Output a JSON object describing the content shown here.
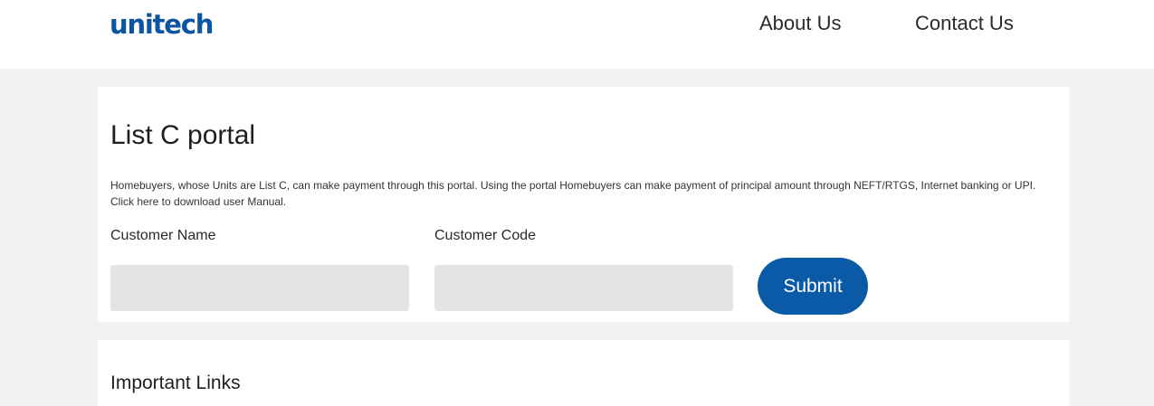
{
  "header": {
    "logo_text": "unitech",
    "nav": {
      "about": "About Us",
      "contact": "Contact Us"
    }
  },
  "portal": {
    "title": "List C portal",
    "description": "Homebuyers, whose Units are List C, can make payment through this portal. Using the portal Homebuyers can make payment of principal amount through NEFT/RTGS, Internet banking or UPI. Click here to download user Manual.",
    "fields": {
      "customer_name_label": "Customer Name",
      "customer_name_value": "",
      "customer_code_label": "Customer Code",
      "customer_code_value": ""
    },
    "submit_label": "Submit"
  },
  "links": {
    "title": "Important Links"
  },
  "colors": {
    "brand": "#0b56a3",
    "button": "#0b5aa8",
    "page_bg": "#f2f2f2",
    "input_bg": "#e4e4e4"
  }
}
